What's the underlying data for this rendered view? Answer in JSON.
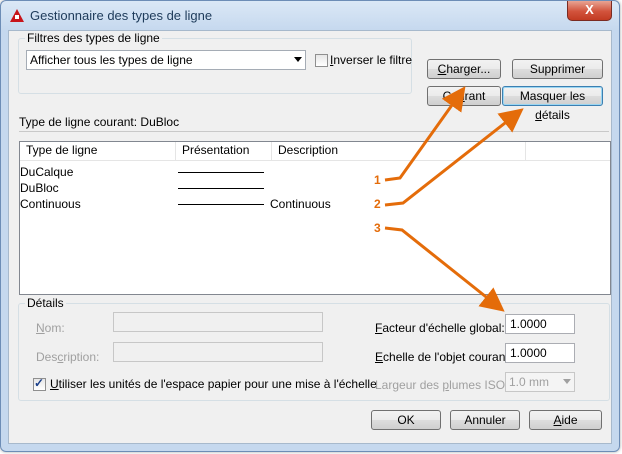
{
  "window": {
    "title": "Gestionnaire des types de ligne",
    "close_glyph": "X"
  },
  "filter": {
    "group_label": "Filtres des types de ligne",
    "combo_value": "Afficher tous les types de ligne",
    "invert_label_pre": "",
    "invert_label_u": "I",
    "invert_label_post": "nverser le filtre",
    "invert_checked": false
  },
  "buttons": {
    "load_u": "C",
    "load_rest": "harger...",
    "delete": "Supprimer",
    "current_pre": "Co",
    "current_u": "u",
    "current_post": "rant",
    "hide_details_pre": "Masquer les ",
    "hide_details_u": "d",
    "hide_details_post": "étails",
    "ok": "OK",
    "cancel": "Annuler",
    "help_u": "A",
    "help_rest": "ide"
  },
  "current_linetype": {
    "label": "Type de ligne courant:",
    "value": "DuBloc"
  },
  "list": {
    "columns": [
      "Type de ligne",
      "Présentation",
      "Description"
    ],
    "rows": [
      {
        "name": "DuCalque",
        "description": ""
      },
      {
        "name": "DuBloc",
        "description": ""
      },
      {
        "name": "Continuous",
        "description": "Continuous"
      }
    ]
  },
  "details": {
    "group_label": "Détails",
    "name_u": "N",
    "name_rest": "om:",
    "description_pre": "Des",
    "description_u": "c",
    "description_post": "ription:",
    "paperspace_u": "U",
    "paperspace_rest": "tiliser les unités de l'espace papier pour une mise à l'échelle",
    "paperspace_checked": true,
    "global_scale_u": "F",
    "global_scale_rest": "acteur d'échelle global:",
    "global_scale_value": "1.0000",
    "object_scale_u": "E",
    "object_scale_rest": "chelle de l'objet courant:",
    "object_scale_value": "1.0000",
    "iso_pen_pre": "Largeur des ",
    "iso_pen_u": "p",
    "iso_pen_post": "lumes ISO:",
    "iso_pen_value": "1.0 mm"
  },
  "callouts": [
    "1",
    "2",
    "3"
  ],
  "colors": {
    "callout": "#e46c0a",
    "title_text": "#1e3b5a",
    "close_button": "#c94a35"
  }
}
